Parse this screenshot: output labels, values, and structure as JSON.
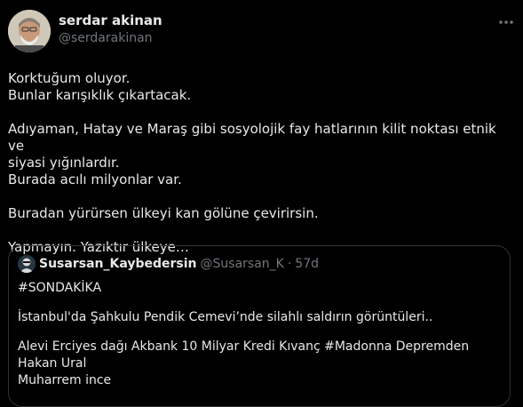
{
  "author": {
    "name": "serdar akinan",
    "handle": "@serdarakinan",
    "avatar_icon": "person-avatar-icon"
  },
  "menu": {
    "icon": "more-horizontal-icon"
  },
  "tweet": {
    "lines": [
      "Korktuğum oluyor.",
      "Bunlar karışıklık çıkartacak.",
      "Adıyaman, Hatay ve Maraş gibi sosyolojik fay hatlarının kilit noktası etnik ve",
      "siyasi yığınlardır.",
      "Burada acılı milyonlar var.",
      "Buradan yürürsen ülkeyi kan gölüne çevirirsin.",
      "Yapmayın. Yazıktır ülkeye…"
    ]
  },
  "quote": {
    "name": "Susarsan_Kaybedersin",
    "handle": "@Susarsan_K",
    "separator": "·",
    "time": "57d",
    "lines": [
      "#SONDAKİKA",
      "İstanbul'da Şahkulu Pendik Cemevi’nde  silahlı saldırın görüntüleri..",
      "Alevi Erciyes dağı Akbank 10 Milyar Kredi Kıvanç #Madonna Depremden Hakan Ural",
      "Muharrem ince"
    ]
  },
  "colors": {
    "background": "#000000",
    "text_primary": "#e7e9ea",
    "text_secondary": "#71767b",
    "border": "#2f3336"
  }
}
